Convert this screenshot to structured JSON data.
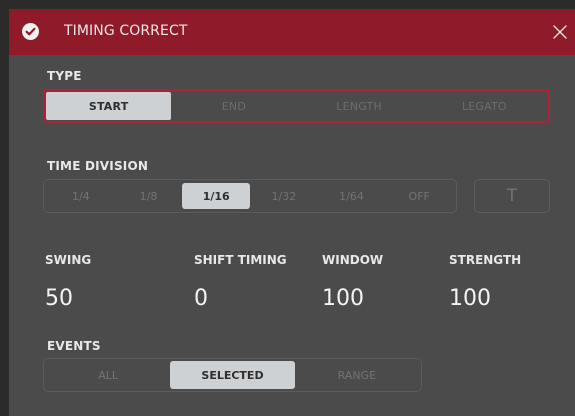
{
  "dialog": {
    "title": "TIMING CORRECT",
    "title_icon": "check-circle-icon",
    "close_icon": "close-icon"
  },
  "type": {
    "label": "TYPE",
    "options": [
      "START",
      "END",
      "LENGTH",
      "LEGATO"
    ],
    "selected": "START"
  },
  "time_division": {
    "label": "TIME DIVISION",
    "options": [
      "1/4",
      "1/8",
      "1/16",
      "1/32",
      "1/64",
      "OFF"
    ],
    "selected": "1/16",
    "triplet_label": "T"
  },
  "params": {
    "swing": {
      "label": "SWING",
      "value": "50"
    },
    "shift_timing": {
      "label": "SHIFT TIMING",
      "value": "0"
    },
    "window": {
      "label": "WINDOW",
      "value": "100"
    },
    "strength": {
      "label": "STRENGTH",
      "value": "100"
    }
  },
  "events": {
    "label": "EVENTS",
    "options": [
      "ALL",
      "SELECTED",
      "RANGE"
    ],
    "selected": "SELECTED"
  },
  "colors": {
    "titlebar": "#8e1a2a",
    "accent_border": "#b51f35",
    "panel": "#4b4b4b",
    "active_option": "#cdd1d4"
  }
}
